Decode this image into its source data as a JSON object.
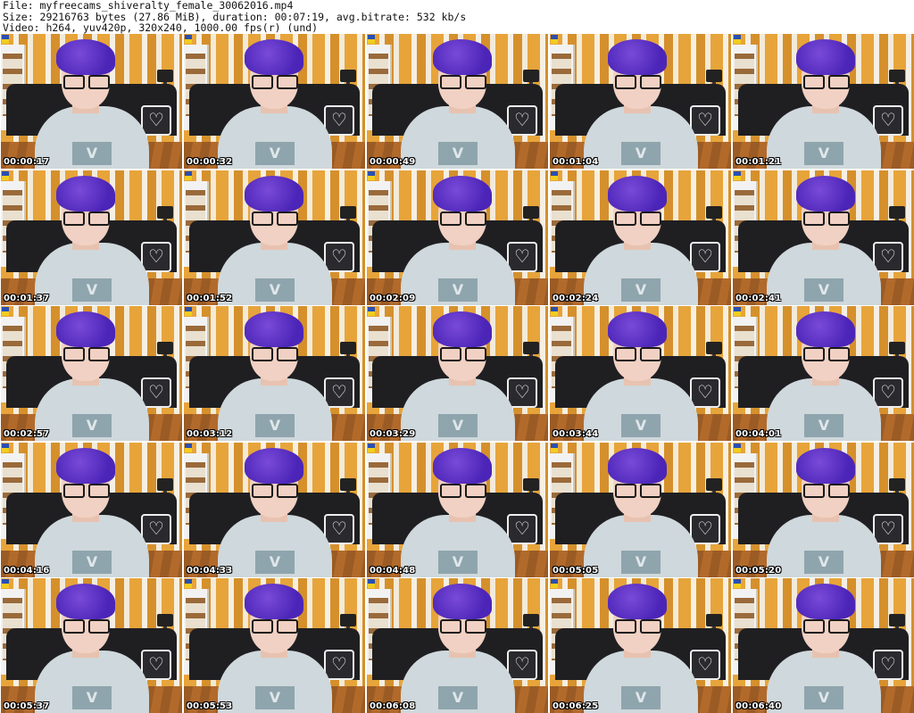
{
  "header": {
    "file_line": "File: myfreecams_shiveralty_female_30062016.mp4",
    "size_line": "Size: 29216763 bytes (27.86 MiB), duration: 00:07:19, avg.bitrate: 532 kb/s",
    "video_line": "Video: h264, yuv420p, 320x240, 1000.00 fps(r) (und)"
  },
  "thumbnails": [
    {
      "timestamp": "00:00:17"
    },
    {
      "timestamp": "00:00:32"
    },
    {
      "timestamp": "00:00:49"
    },
    {
      "timestamp": "00:01:04"
    },
    {
      "timestamp": "00:01:21"
    },
    {
      "timestamp": "00:01:37"
    },
    {
      "timestamp": "00:01:52"
    },
    {
      "timestamp": "00:02:09"
    },
    {
      "timestamp": "00:02:24"
    },
    {
      "timestamp": "00:02:41"
    },
    {
      "timestamp": "00:02:57"
    },
    {
      "timestamp": "00:03:12"
    },
    {
      "timestamp": "00:03:29"
    },
    {
      "timestamp": "00:03:44"
    },
    {
      "timestamp": "00:04:01"
    },
    {
      "timestamp": "00:04:16"
    },
    {
      "timestamp": "00:04:33"
    },
    {
      "timestamp": "00:04:48"
    },
    {
      "timestamp": "00:05:05"
    },
    {
      "timestamp": "00:05:20"
    },
    {
      "timestamp": "00:05:37"
    },
    {
      "timestamp": "00:05:53"
    },
    {
      "timestamp": "00:06:08"
    },
    {
      "timestamp": "00:06:25"
    },
    {
      "timestamp": "00:06:40"
    }
  ],
  "colors": {
    "background": "#ffffff",
    "hair": "#5a2fc4",
    "timestamp_text": "#ffffff"
  }
}
